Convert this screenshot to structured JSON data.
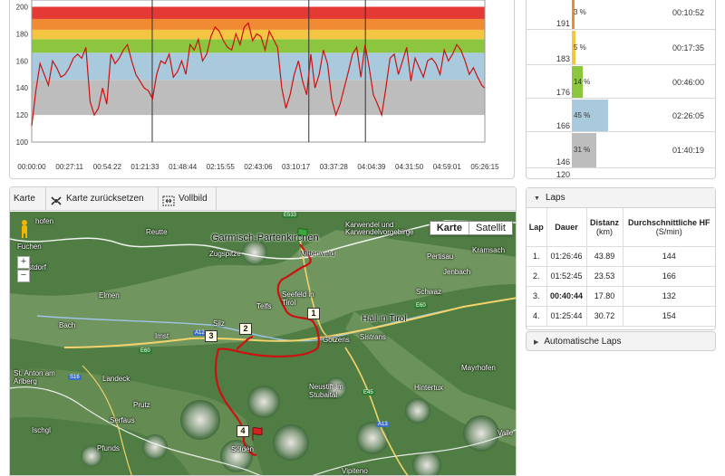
{
  "chart_data": {
    "type": "line",
    "ylim": [
      100,
      205
    ],
    "yticks": [
      100,
      120,
      140,
      160,
      180,
      200
    ],
    "xlim_seconds": [
      0,
      19575
    ],
    "xticks": [
      "00:00:00",
      "00:27:11",
      "00:54:22",
      "01:21:33",
      "01:48:44",
      "02:15:55",
      "02:43:06",
      "03:10:17",
      "03:37:28",
      "04:04:39",
      "04:31:50",
      "04:59:01",
      "05:26:15"
    ],
    "zones": [
      {
        "from": 100,
        "to": 120,
        "color": "#ffffff"
      },
      {
        "from": 120,
        "to": 146,
        "color": "#bdbdbd"
      },
      {
        "from": 146,
        "to": 166,
        "color": "#a9c9dd"
      },
      {
        "from": 166,
        "to": 176,
        "color": "#8cc63e"
      },
      {
        "from": 176,
        "to": 183,
        "color": "#f3c542"
      },
      {
        "from": 183,
        "to": 191,
        "color": "#f08a33"
      },
      {
        "from": 191,
        "to": 200,
        "color": "#e53935"
      }
    ],
    "lap_lines": [
      "01:26:46",
      "03:19:31",
      "04:00:15"
    ],
    "series": [
      {
        "color": "#cc1111",
        "x_minutes": [
          0,
          3,
          6,
          9,
          12,
          15,
          18,
          21,
          24,
          27,
          30,
          33,
          36,
          39,
          42,
          45,
          48,
          51,
          54,
          57,
          60,
          63,
          66,
          69,
          72,
          75,
          78,
          81,
          84,
          87,
          90,
          93,
          96,
          99,
          102,
          105,
          108,
          111,
          114,
          117,
          120,
          123,
          126,
          129,
          132,
          135,
          138,
          141,
          144,
          147,
          150,
          153,
          156,
          159,
          162,
          165,
          168,
          171,
          174,
          177,
          180,
          183,
          186,
          189,
          192,
          195,
          198,
          201,
          204,
          207,
          210,
          213,
          216,
          219,
          222,
          225,
          228,
          231,
          234,
          237,
          240,
          243,
          246,
          249,
          252,
          255,
          258,
          261,
          264,
          267,
          270,
          273,
          276,
          279,
          282,
          285,
          288,
          291,
          294,
          297,
          300,
          303,
          306,
          309,
          312,
          315,
          318,
          321,
          324,
          326
        ],
        "hr": [
          112,
          138,
          158,
          150,
          142,
          160,
          155,
          148,
          150,
          155,
          162,
          165,
          162,
          170,
          130,
          120,
          125,
          140,
          128,
          165,
          158,
          162,
          168,
          172,
          160,
          150,
          145,
          140,
          138,
          132,
          150,
          160,
          158,
          165,
          148,
          152,
          160,
          150,
          172,
          168,
          176,
          160,
          165,
          178,
          185,
          182,
          175,
          170,
          168,
          180,
          172,
          185,
          188,
          175,
          180,
          178,
          168,
          182,
          176,
          170,
          140,
          125,
          135,
          150,
          160,
          145,
          135,
          165,
          140,
          150,
          168,
          158,
          132,
          120,
          128,
          140,
          152,
          165,
          170,
          148,
          172,
          155,
          135,
          128,
          120,
          140,
          162,
          165,
          150,
          160,
          170,
          145,
          162,
          155,
          148,
          160,
          162,
          158,
          150,
          168,
          160,
          165,
          172,
          168,
          160,
          150,
          155,
          148,
          142,
          140
        ]
      }
    ]
  },
  "zone_table": [
    {
      "limit": "191",
      "pct": "3 %",
      "time": "00:10:52",
      "color": "#f08a33",
      "fraction": 0.03
    },
    {
      "limit": "183",
      "pct": "5 %",
      "time": "00:17:35",
      "color": "#f3c542",
      "fraction": 0.05
    },
    {
      "limit": "176",
      "pct": "14 %",
      "time": "00:46:00",
      "color": "#8cc63e",
      "fraction": 0.14
    },
    {
      "limit": "166",
      "pct": "45 %",
      "time": "02:26:05",
      "color": "#a9c9dd",
      "fraction": 0.45
    },
    {
      "limit": "146",
      "pct": "31 %",
      "time": "01:40:19",
      "color": "#bdbdbd",
      "fraction": 0.31
    },
    {
      "limit": "120",
      "pct": "",
      "time": "",
      "color": "#ffffff",
      "fraction": 0
    }
  ],
  "map": {
    "toolbar": {
      "map_label": "Karte",
      "reset_label": "Karte zurücksetzen",
      "fullscreen_label": "Vollbild"
    },
    "type_buttons": {
      "map": "Karte",
      "satellite": "Satellit"
    },
    "places": {
      "garmisch": "Garmisch-Partenkirchen",
      "reutte": "Reutte",
      "zugspitze": "Zugspitze",
      "karwendel": "Karwendel und Karwendelvorgebirge",
      "pertisau": "Pertisau",
      "kramsach": "Kramsach",
      "jenbach": "Jenbach",
      "mittenwald": "Mittenwald",
      "seefeld": "Seefeld in Tirol",
      "telfs": "Telfs",
      "schwaz": "Schwaz",
      "elmen": "Elmen",
      "bach": "Bach",
      "hall": "Hall in Tirol",
      "silz": "Silz",
      "imst": "Imst",
      "gotzens": "Götzens",
      "sistrans": "Sistrans",
      "hofen": "hofen",
      "fuchen": "Fuchen",
      "stdorf": "stdorf",
      "anton": "St. Anton am Arlberg",
      "landeck": "Landeck",
      "mayrhofen": "Mayrhofen",
      "neustift": "Neustift im Stubaital",
      "hintertux": "Hintertux",
      "prutz": "Prutz",
      "serfaus": "Serfaus",
      "ischgl": "Ischgl",
      "pfunds": "Pfunds",
      "solden": "Sölden",
      "valle": "Valle",
      "vipitena": "Vipiteno"
    },
    "road_badges": {
      "e533": "E533",
      "e60a": "E60",
      "e60b": "E60",
      "a12": "A12",
      "s16": "S16",
      "e45": "E45",
      "a13": "A13"
    },
    "lap_markers": [
      "1",
      "2",
      "3",
      "4"
    ]
  },
  "laps": {
    "title": "Laps",
    "headers": {
      "lap": "Lap",
      "duration": "Dauer",
      "distance": "Distanz",
      "distance_unit": "(km)",
      "avg_hr": "Durchschnittliche HF",
      "avg_hr_unit": "(S/min)"
    },
    "rows": [
      {
        "lap": "1.",
        "duration": "01:26:46",
        "distance": "43.89",
        "avg_hr": "144"
      },
      {
        "lap": "2.",
        "duration": "01:52:45",
        "distance": "23.53",
        "avg_hr": "166"
      },
      {
        "lap": "3.",
        "duration": "00:40:44",
        "distance": "17.80",
        "avg_hr": "132"
      },
      {
        "lap": "4.",
        "duration": "01:25:44",
        "distance": "30.72",
        "avg_hr": "154"
      }
    ]
  },
  "auto_laps": {
    "title": "Automatische Laps"
  }
}
